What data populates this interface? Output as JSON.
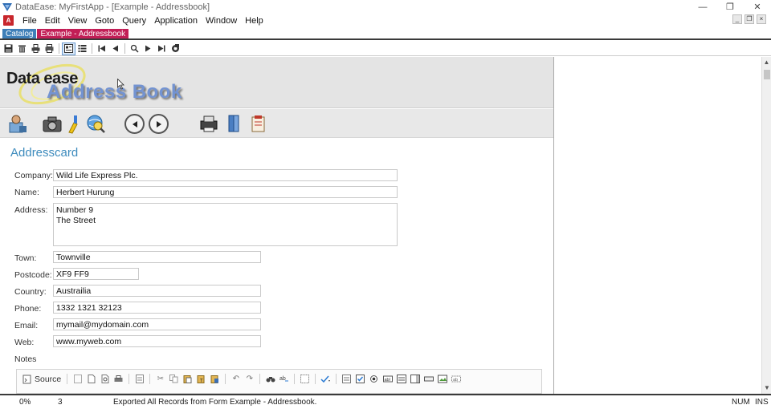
{
  "window": {
    "title": "DataEase: MyFirstApp - [Example - Addressbook]",
    "controls": [
      "—",
      "❐",
      "✕"
    ]
  },
  "menu": {
    "items": [
      "File",
      "Edit",
      "View",
      "Goto",
      "Query",
      "Application",
      "Window",
      "Help"
    ]
  },
  "tabs": [
    {
      "label": "Catalog"
    },
    {
      "label": "Example - Addressbook"
    }
  ],
  "toolbar": {
    "icons": [
      "save-icon",
      "delete-icon",
      "print-icon",
      "printer-icon",
      "form-view-icon",
      "list-view-icon",
      "first-record-icon",
      "previous-record-icon",
      "search-icon",
      "next-record-icon",
      "last-record-icon",
      "refresh-icon"
    ]
  },
  "banner": {
    "logo_text": "Data ease",
    "subtitle": "Address Book"
  },
  "form": {
    "title": "Addresscard",
    "fields": {
      "company": {
        "label": "Company:",
        "value": "Wild Life Express Plc."
      },
      "name": {
        "label": "Name:",
        "value": "Herbert Hurung"
      },
      "address": {
        "label": "Address:",
        "value": "Number 9\nThe Street"
      },
      "town": {
        "label": "Town:",
        "value": "Townville"
      },
      "postcode": {
        "label": "Postcode:",
        "value": "XF9 FF9"
      },
      "country": {
        "label": "Country:",
        "value": "Austrailia"
      },
      "phone": {
        "label": "Phone:",
        "value": "1332 1321 32123"
      },
      "email": {
        "label": "Email:",
        "value": "mymail@mydomain.com"
      },
      "web": {
        "label": "Web:",
        "value": "www.myweb.com"
      }
    },
    "notes_label": "Notes",
    "editor": {
      "source_label": "Source"
    }
  },
  "status": {
    "percent": "0%",
    "count": "3",
    "message": "Exported All Records from Form Example - Addressbook.",
    "num": "NUM",
    "ins": "INS"
  },
  "colors": {
    "tab_catalog": "#3e7fb8",
    "tab_active": "#c21e56",
    "section_title": "#3d8bbd",
    "banner_subtitle": "#6e8fd0"
  }
}
